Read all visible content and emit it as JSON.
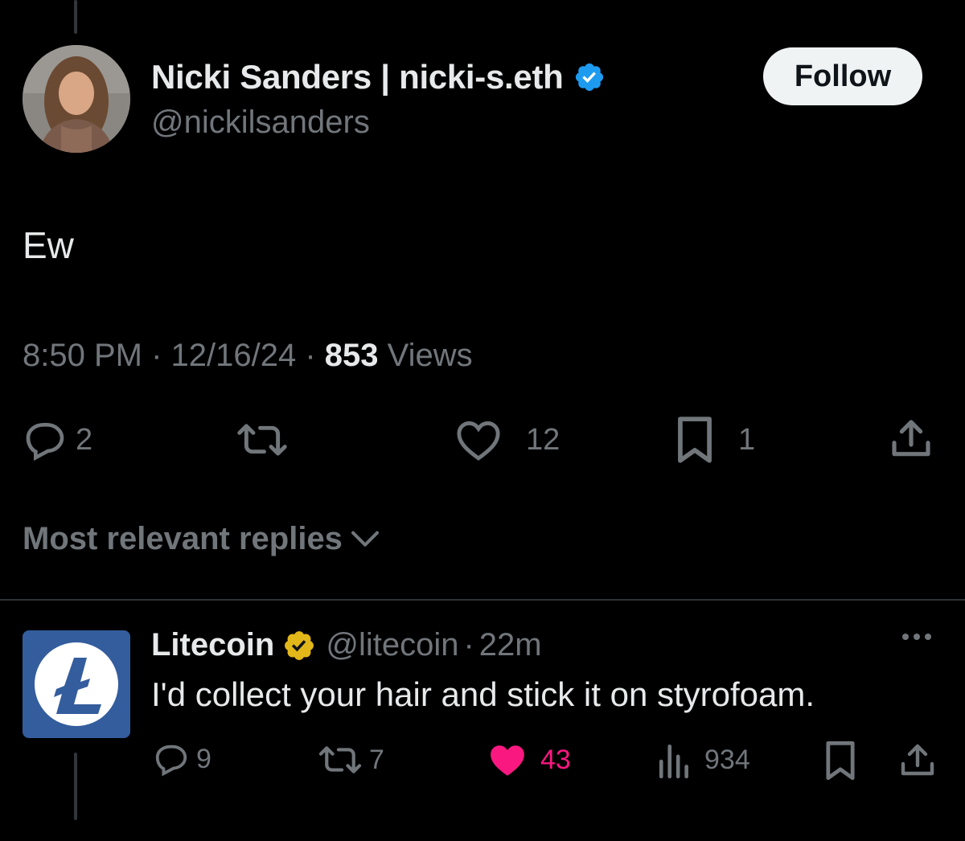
{
  "tweet": {
    "author_name": "Nicki Sanders | nicki-s.eth",
    "author_handle": "@nickilsanders",
    "follow_label": "Follow",
    "text": "Ew",
    "time": "8:50 PM",
    "date": "12/16/24",
    "views_count": "853",
    "views_label": "Views",
    "replies": "2",
    "likes": "12",
    "bookmarks": "1",
    "verified_badge_color": "#1d9bf0"
  },
  "replies_sort": {
    "label": "Most relevant replies"
  },
  "reply": {
    "author_name": "Litecoin",
    "author_handle": "@litecoin",
    "time_ago": "22m",
    "text": "I'd collect your hair and stick it on styrofoam.",
    "replies": "9",
    "reposts": "7",
    "likes": "43",
    "views": "934",
    "like_color": "#f91880",
    "verified_badge_color": "#e2b719",
    "logo_color": "#345d9d"
  }
}
